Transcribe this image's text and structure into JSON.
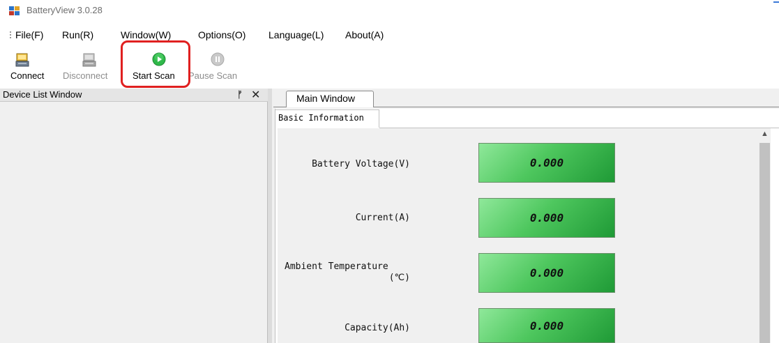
{
  "window": {
    "title": "BatteryView 3.0.28"
  },
  "menu": [
    "File(F)",
    "Run(R)",
    "Window(W)",
    "Options(O)",
    "Language(L)",
    "About(A)"
  ],
  "toolbar": {
    "connect": "Connect",
    "disconnect": "Disconnect",
    "start_scan": "Start Scan",
    "pause_scan": "Pause Scan"
  },
  "device_list": {
    "title": "Device List Window"
  },
  "main_window": {
    "tab": "Main Window",
    "sub_tab": "Basic Information",
    "fields": [
      {
        "label_lines": [
          "Battery Voltage(V)"
        ],
        "value": "0.000"
      },
      {
        "label_lines": [
          "Current(A)"
        ],
        "value": "0.000"
      },
      {
        "label_lines": [
          "Ambient Temperature",
          "(℃)"
        ],
        "value": "0.000"
      },
      {
        "label_lines": [
          "Capacity(Ah)"
        ],
        "value": "0.000"
      }
    ]
  },
  "colors": {
    "highlight": "#e02020",
    "value_green": "#4ec75e",
    "play_green": "#2fb94a"
  }
}
